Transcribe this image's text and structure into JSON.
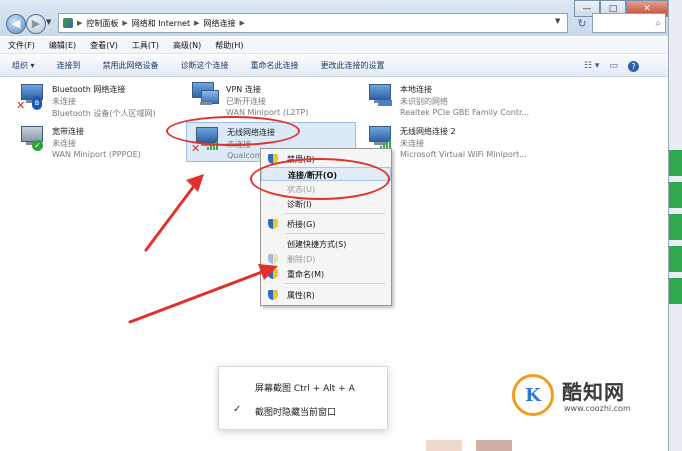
{
  "address_bar": {
    "crumbs": [
      "控制面板",
      "网络和 Internet",
      "网络连接"
    ],
    "search_placeholder": "",
    "refresh_symbol": "↻"
  },
  "window_controls": {
    "minimize": "—",
    "maximize": "□",
    "close": "✕"
  },
  "menu_bar": [
    "文件(F)",
    "编辑(E)",
    "查看(V)",
    "工具(T)",
    "高级(N)",
    "帮助(H)"
  ],
  "toolbar": {
    "items": [
      "组织 ▾",
      "连接到",
      "禁用此网络设备",
      "诊断这个连接",
      "重命名此连接",
      "更改此连接的设置"
    ],
    "right_icons": [
      "view-options-icon",
      "preview-pane-icon",
      "help-icon"
    ]
  },
  "adapters": [
    {
      "name": "Bluetooth 网络连接",
      "status": "未连接",
      "device": "Bluetooth 设备(个人区域网)",
      "overlay": "bluetooth-disconnected"
    },
    {
      "name": "VPN 连接",
      "status": "已断开连接",
      "device": "WAN Miniport (L2TP)",
      "overlay": "none"
    },
    {
      "name": "本地连接",
      "status": "未识别的网络",
      "device": "Realtek PCIe GBE Family Contr...",
      "overlay": "none"
    },
    {
      "name": "宽带连接",
      "status": "未连接",
      "device": "WAN Miniport (PPPOE)",
      "overlay": "checkmark"
    },
    {
      "name": "无线网络连接",
      "status": "未连接",
      "device": "Qualcom",
      "overlay": "disconnected-signal",
      "selected": true
    },
    {
      "name": "无线网络连接 2",
      "status": "未连接",
      "device": "Microsoft Virtual WiFi Miniport...",
      "overlay": "signal"
    }
  ],
  "context_menu": {
    "items": [
      {
        "label": "禁用(B)",
        "enabled": true,
        "icon": "shield-icon"
      },
      {
        "label": "连接/断开(O)",
        "enabled": true,
        "bold": true,
        "highlighted": true
      },
      {
        "label": "状态(U)",
        "enabled": false
      },
      {
        "label": "诊断(I)",
        "enabled": true
      },
      {
        "label": "桥接(G)",
        "enabled": true,
        "icon": "shield-icon"
      },
      {
        "label": "创建快捷方式(S)",
        "enabled": true
      },
      {
        "label": "删除(D)",
        "enabled": false,
        "icon": "shield-icon"
      },
      {
        "label": "重命名(M)",
        "enabled": true,
        "icon": "shield-icon"
      },
      {
        "label": "属性(R)",
        "enabled": true,
        "icon": "shield-icon"
      }
    ]
  },
  "screenshot_popup": {
    "shortcut_label": "屏幕截图 Ctrl + Alt + A",
    "hide_window_label": "截图时隐藏当前窗口",
    "hide_window_checked": true
  },
  "watermark": {
    "name": "酷知网",
    "url": "www.coozhi.com",
    "logo_letter": "K"
  },
  "colors": {
    "annotation_red": "#e0312b",
    "accent_blue": "#2d62a8",
    "green_strip": "#2fa84f"
  }
}
